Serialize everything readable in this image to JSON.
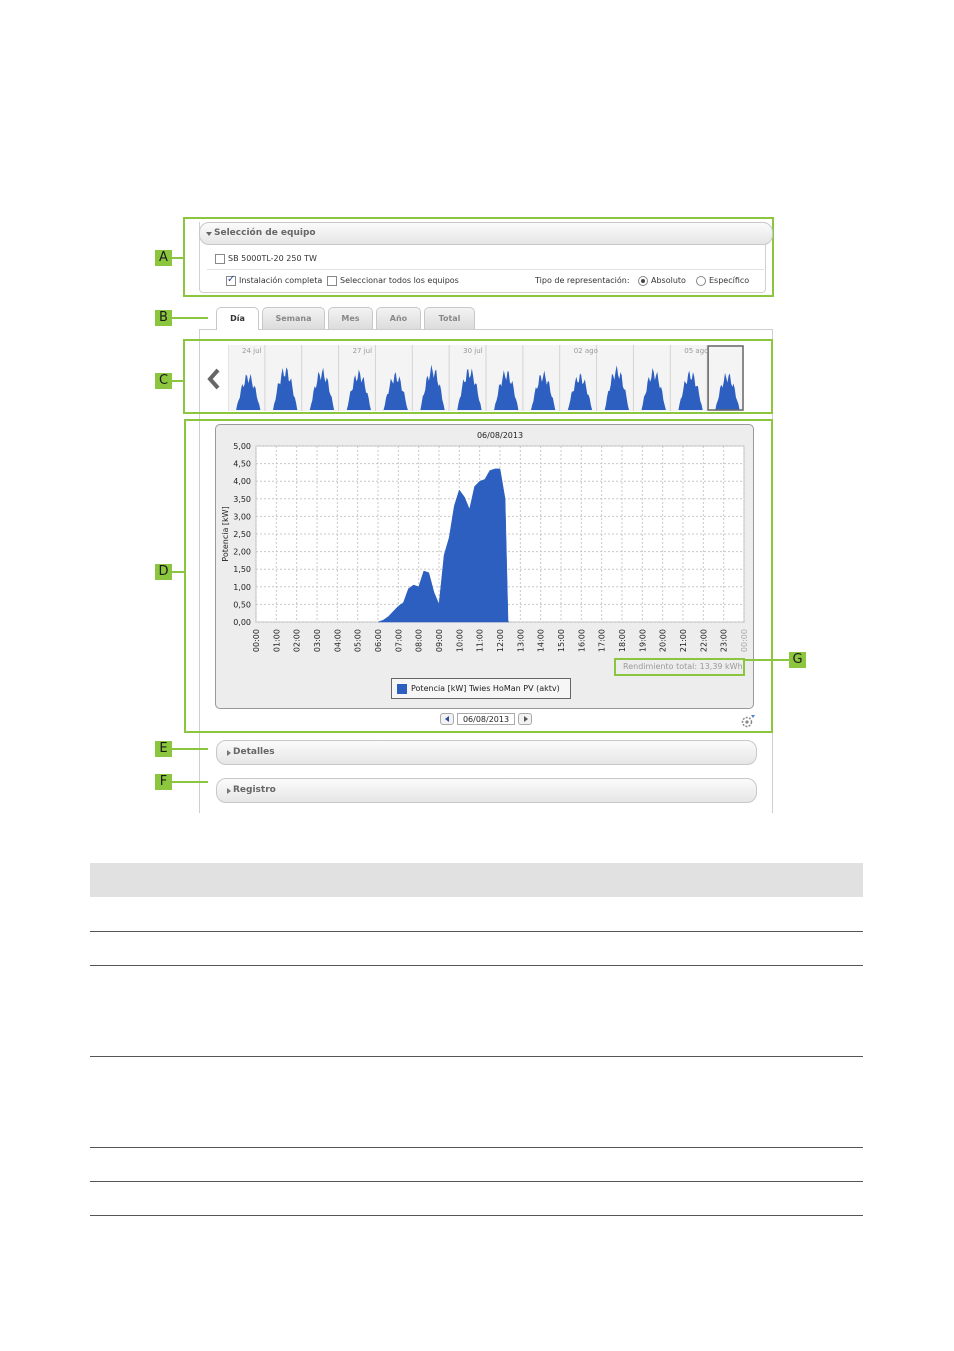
{
  "device_selection": {
    "header": "Selección de equipo",
    "device_label": "SB 5000TL-20 250 TW",
    "full_install_label": "Instalación completa",
    "select_all_label": "Seleccionar todos los equipos",
    "representation_label": "Tipo de representación:",
    "option_absolute": "Absoluto",
    "option_specific": "Específico",
    "selected_option": "Absoluto",
    "full_install_checked": true,
    "select_all_checked": false,
    "device_checked": false
  },
  "tabs": [
    {
      "label": "Día",
      "active": true
    },
    {
      "label": "Semana",
      "active": false
    },
    {
      "label": "Mes",
      "active": false
    },
    {
      "label": "Año",
      "active": false
    },
    {
      "label": "Total",
      "active": false
    }
  ],
  "thumbnails": {
    "date_labels": [
      "24 jul",
      "27 jul",
      "30 jul",
      "02 ago",
      "05 ago"
    ],
    "day_count": 14,
    "selected_index": 13
  },
  "chart": {
    "title": "06/08/2013",
    "ylabel": "Potencia [kW]",
    "yield_text": "Rendimiento total: 13,39 kWh",
    "legend": "Potencia [kW] Twies HoMan PV (aktv)"
  },
  "chart_data": {
    "type": "area",
    "title": "06/08/2013",
    "ylabel": "Potencia [kW]",
    "ylim": [
      0,
      5
    ],
    "y_ticks": [
      "0,00",
      "0,50",
      "1,00",
      "1,50",
      "2,00",
      "2,50",
      "3,00",
      "3,50",
      "4,00",
      "4,50",
      "5,00"
    ],
    "x_ticks": [
      "00:00",
      "01:00",
      "02:00",
      "03:00",
      "04:00",
      "05:00",
      "06:00",
      "07:00",
      "08:00",
      "09:00",
      "10:00",
      "11:00",
      "12:00",
      "13:00",
      "14:00",
      "15:00",
      "16:00",
      "17:00",
      "18:00",
      "19:00",
      "20:00",
      "21:00",
      "22:00",
      "23:00",
      "00:00"
    ],
    "series": [
      {
        "name": "Potencia [kW] Twies HoMan PV (aktv)",
        "color": "#2c5fbf",
        "x": [
          6.0,
          6.25,
          6.5,
          6.75,
          7.0,
          7.25,
          7.5,
          7.75,
          8.0,
          8.25,
          8.5,
          8.75,
          9.0,
          9.25,
          9.5,
          9.75,
          10.0,
          10.25,
          10.5,
          10.75,
          11.0,
          11.25,
          11.5,
          11.75,
          12.0,
          12.25,
          12.4,
          12.45
        ],
        "values": [
          0.0,
          0.05,
          0.15,
          0.3,
          0.45,
          0.55,
          0.95,
          1.05,
          1.0,
          1.45,
          1.4,
          0.85,
          0.5,
          1.9,
          2.4,
          3.3,
          3.75,
          3.55,
          3.2,
          3.85,
          4.0,
          4.05,
          4.3,
          4.35,
          4.35,
          3.5,
          0.0,
          0.0
        ]
      }
    ],
    "grid": true,
    "legend_position": "bottom"
  },
  "date_nav": {
    "date": "06/08/2013"
  },
  "sections": {
    "details": "Detalles",
    "log": "Registro"
  },
  "callouts": [
    "A",
    "B",
    "C",
    "D",
    "E",
    "F",
    "G"
  ],
  "colors": {
    "callout_green": "#8cc63f",
    "chart_blue": "#2c5fbf"
  }
}
